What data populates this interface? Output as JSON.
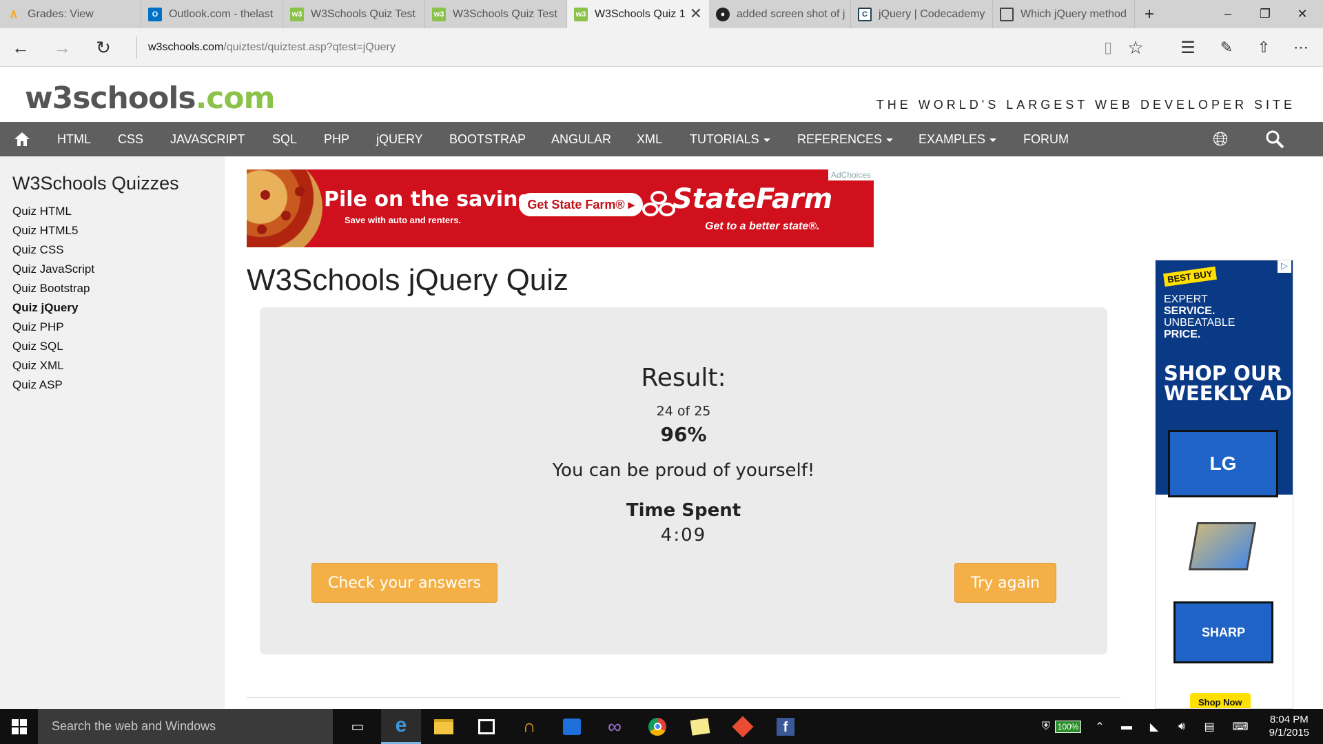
{
  "browser": {
    "tabs": [
      {
        "title": "Grades: View",
        "icon": "moodle-icon",
        "color": "#f9a825"
      },
      {
        "title": "Outlook.com - thelast",
        "icon": "outlook-icon",
        "color": "#0072c6"
      },
      {
        "title": "W3Schools Quiz Test",
        "icon": "w3schools-icon",
        "color": "#8bc34a"
      },
      {
        "title": "W3Schools Quiz Test",
        "icon": "w3schools-icon",
        "color": "#8bc34a"
      },
      {
        "title": "W3Schools Quiz 1",
        "icon": "w3schools-icon",
        "color": "#8bc34a",
        "active": true
      },
      {
        "title": "added screen shot of j",
        "icon": "github-icon",
        "color": "#222222"
      },
      {
        "title": "jQuery | Codecademy",
        "icon": "codecademy-icon",
        "color": "#1f4056"
      },
      {
        "title": "Which jQuery method",
        "icon": "page-icon",
        "color": "#444444"
      }
    ],
    "url_host": "w3schools.com",
    "url_path": "/quiztest/quiztest.asp?qtest=jQuery"
  },
  "site": {
    "logo_main": "w3schools",
    "logo_com": ".com",
    "slogan": "THE WORLD'S LARGEST WEB DEVELOPER SITE",
    "nav": [
      {
        "label": "HTML"
      },
      {
        "label": "CSS"
      },
      {
        "label": "JAVASCRIPT"
      },
      {
        "label": "SQL"
      },
      {
        "label": "PHP"
      },
      {
        "label": "jQUERY"
      },
      {
        "label": "BOOTSTRAP"
      },
      {
        "label": "ANGULAR"
      },
      {
        "label": "XML"
      },
      {
        "label": "TUTORIALS",
        "dropdown": true
      },
      {
        "label": "REFERENCES",
        "dropdown": true
      },
      {
        "label": "EXAMPLES",
        "dropdown": true
      },
      {
        "label": "FORUM"
      }
    ]
  },
  "sidebar": {
    "title": "W3Schools Quizzes",
    "items": [
      {
        "label": "Quiz HTML"
      },
      {
        "label": "Quiz HTML5"
      },
      {
        "label": "Quiz CSS"
      },
      {
        "label": "Quiz JavaScript"
      },
      {
        "label": "Quiz Bootstrap"
      },
      {
        "label": "Quiz jQuery",
        "active": true
      },
      {
        "label": "Quiz PHP"
      },
      {
        "label": "Quiz SQL"
      },
      {
        "label": "Quiz XML"
      },
      {
        "label": "Quiz ASP"
      }
    ]
  },
  "banner_ad": {
    "headline": "Pile on the savings.",
    "subline": "Save with auto and renters.",
    "cta": "Get State Farm® ▸",
    "brand": "StateFarm",
    "tagline": "Get to a better state®.",
    "adchoices": "AdChoices"
  },
  "quiz": {
    "title": "W3Schools jQuery Quiz",
    "result_label": "Result:",
    "score": "24 of 25",
    "percent": "96%",
    "message": "You can be proud of yourself!",
    "time_label": "Time Spent",
    "time_value": "4:09",
    "check_button": "Check your answers",
    "try_again_button": "Try again"
  },
  "side_ad": {
    "brand": "BEST BUY",
    "line1": "EXPERT",
    "line2": "SERVICE.",
    "line3": "UNBEATABLE",
    "line4": "PRICE.",
    "headline1": "SHOP OUR",
    "headline2": "WEEKLY AD",
    "tv1": "LG",
    "tv3": "SHARP",
    "shop_now": "Shop Now"
  },
  "taskbar": {
    "search_placeholder": "Search the web and Windows",
    "battery": "100%",
    "time": "8:04 PM",
    "date": "9/1/2015"
  }
}
